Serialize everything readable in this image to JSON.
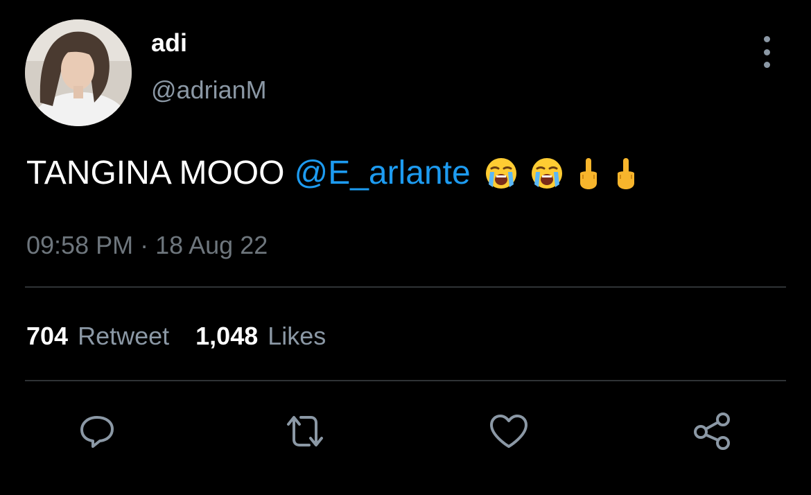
{
  "user": {
    "display_name": "adi",
    "handle": "@adrianM"
  },
  "tweet": {
    "text": "TANGINA MOOO",
    "mention": "@E_arlante",
    "emojis": [
      "loudly-crying-face-emoji",
      "loudly-crying-face-emoji",
      "middle-finger-emoji",
      "middle-finger-emoji"
    ],
    "timestamp": "09:58 PM · 18 Aug 22"
  },
  "stats": {
    "retweets_count": "704",
    "retweets_label": "Retweet",
    "likes_count": "1,048",
    "likes_label": "Likes"
  },
  "actions": [
    "reply-icon",
    "retweet-icon",
    "like-icon",
    "share-icon"
  ],
  "colors": {
    "background": "#000000",
    "text": "#ffffff",
    "secondary": "#8b98a5",
    "link": "#1d9bf0",
    "divider": "#2f3336"
  }
}
